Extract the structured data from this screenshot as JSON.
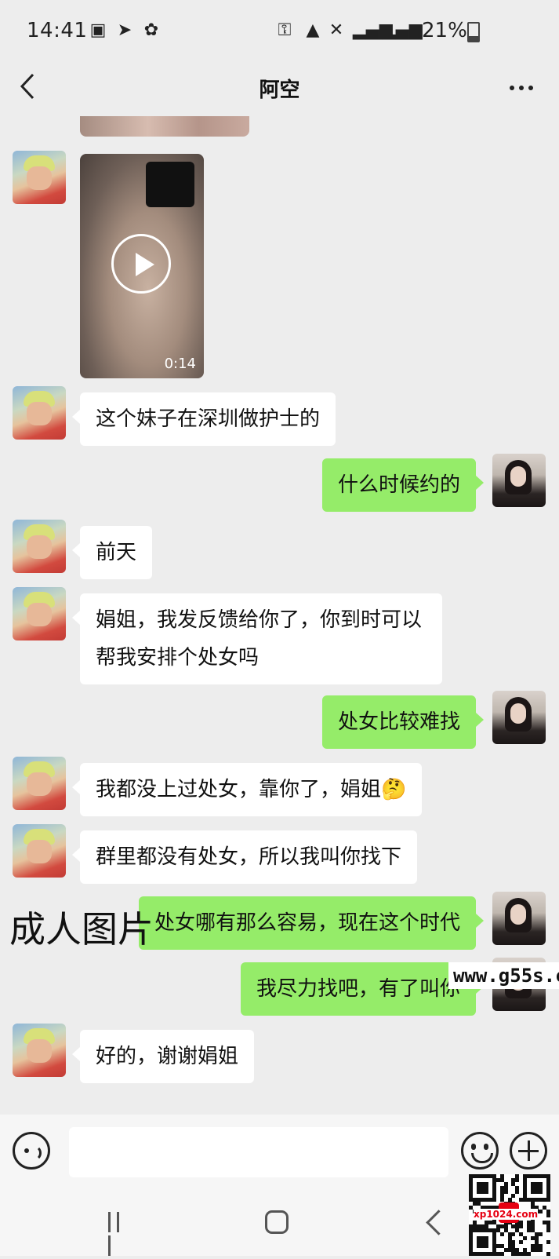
{
  "status_bar": {
    "time": "14:41",
    "battery_text": "21%"
  },
  "header": {
    "title": "阿空"
  },
  "messages": [
    {
      "side": "left",
      "type": "video",
      "duration": "0:14"
    },
    {
      "side": "left",
      "type": "text",
      "text": "这个妹子在深圳做护士的"
    },
    {
      "side": "right",
      "type": "text",
      "text": "什么时候约的"
    },
    {
      "side": "left",
      "type": "text",
      "text": "前天"
    },
    {
      "side": "left",
      "type": "text",
      "text": "娟姐，我发反馈给你了，你到时可以帮我安排个处女吗"
    },
    {
      "side": "right",
      "type": "text",
      "text": "处女比较难找"
    },
    {
      "side": "left",
      "type": "text",
      "text": "我都没上过处女，靠你了，娟姐🤔"
    },
    {
      "side": "left",
      "type": "text",
      "text": "群里都没有处女，所以我叫你找下"
    },
    {
      "side": "right",
      "type": "text",
      "text": "处女哪有那么容易，现在这个时代"
    },
    {
      "side": "right",
      "type": "text",
      "text": "我尽力找吧，有了叫你"
    },
    {
      "side": "left",
      "type": "text",
      "text": "好的，谢谢娟姐"
    }
  ],
  "watermarks": {
    "overlay_text": "成人图片",
    "site_text": "www.g55s.c",
    "qr_text": "xp1024.com"
  },
  "colors": {
    "background": "#ededed",
    "bubble_in": "#ffffff",
    "bubble_out": "#95ec69"
  },
  "icons": {
    "back": "chevron-left-icon",
    "more": "more-dots-icon",
    "play": "play-icon",
    "voice": "voice-icon",
    "emoji": "emoji-icon",
    "plus": "plus-icon"
  }
}
